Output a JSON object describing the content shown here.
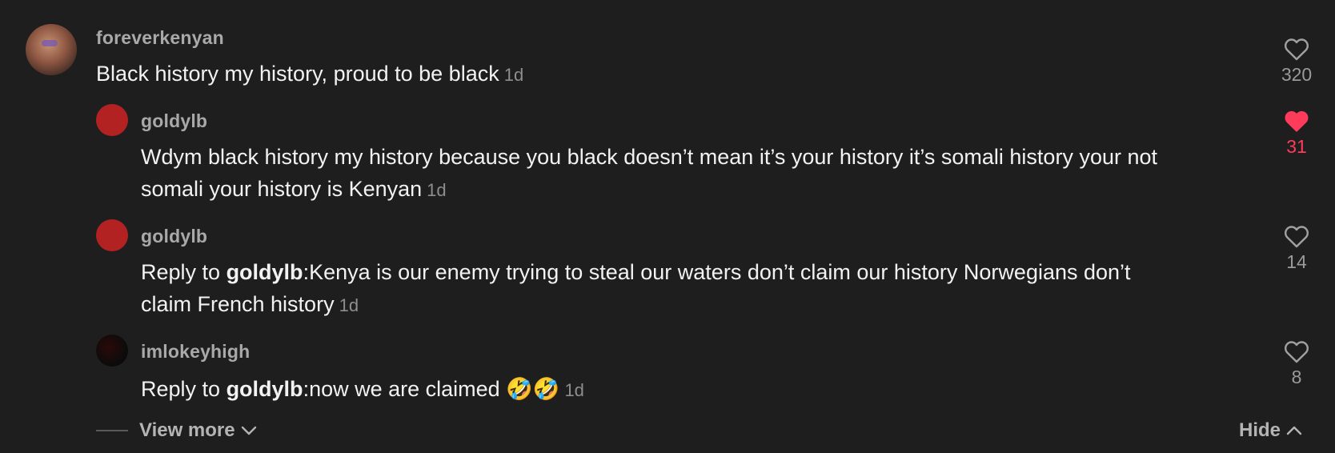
{
  "comments": [
    {
      "username": "foreverkenyan",
      "text": "Black history my history, proud to be black",
      "time": "1d",
      "likes": "320",
      "liked": false
    },
    {
      "username": "goldylb",
      "line1": "Wdym black history my history because you black doesn’t mean it’s your history it’s somali history your not",
      "line2": "somali your history is Kenyan",
      "time": "1d",
      "likes": "31",
      "liked": true
    },
    {
      "username": "goldylb",
      "reply_prefix": "Reply to ",
      "reply_to": "goldylb",
      "line1_rest": ":Kenya is our enemy trying to steal our waters don’t claim our history Norwegians don’t",
      "line2": "claim French history",
      "time": "1d",
      "likes": "14",
      "liked": false
    },
    {
      "username": "imlokeyhigh",
      "reply_prefix": "Reply to ",
      "reply_to": "goldylb",
      "text_rest": ":now we are claimed ",
      "emoji": "🤣🤣",
      "time": "1d",
      "likes": "8",
      "liked": false
    }
  ],
  "footer": {
    "view_more": "View more",
    "hide": "Hide"
  },
  "colors": {
    "background": "#1e1e1e",
    "like_active": "#ff3b5c",
    "username": "#a9a9a9",
    "text": "#f2f2f2"
  }
}
